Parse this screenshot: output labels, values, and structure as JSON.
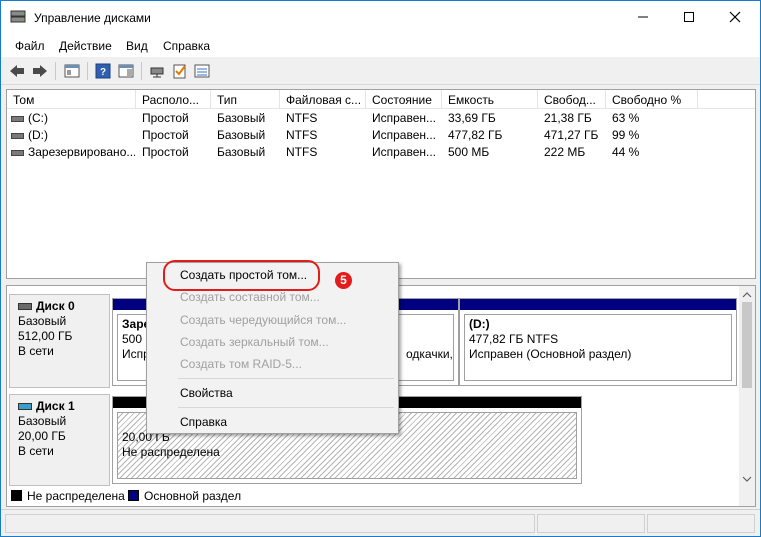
{
  "window": {
    "title": "Управление дисками"
  },
  "menu": [
    "Файл",
    "Действие",
    "Вид",
    "Справка"
  ],
  "volume_table": {
    "columns": [
      "Том",
      "Располо...",
      "Тип",
      "Файловая с...",
      "Состояние",
      "Емкость",
      "Свобод...",
      "Свободно %"
    ],
    "rows": [
      [
        "(C:)",
        "Простой",
        "Базовый",
        "NTFS",
        "Исправен...",
        "33,69 ГБ",
        "21,38 ГБ",
        "63 %"
      ],
      [
        "(D:)",
        "Простой",
        "Базовый",
        "NTFS",
        "Исправен...",
        "477,82 ГБ",
        "471,27 ГБ",
        "99 %"
      ],
      [
        "Зарезервировано...",
        "Простой",
        "Базовый",
        "NTFS",
        "Исправен...",
        "500 МБ",
        "222 МБ",
        "44 %"
      ]
    ]
  },
  "disks": [
    {
      "name": "Диск 0",
      "type": "Базовый",
      "size": "512,00 ГБ",
      "status": "В сети",
      "partitions": [
        {
          "name": "Заре",
          "line2": "500 М",
          "line3": "Испр"
        },
        {
          "name": "",
          "line2": "",
          "line3": "одкачки,"
        },
        {
          "name": "(D:)",
          "line2": "477,82 ГБ NTFS",
          "line3": "Исправен (Основной раздел)"
        }
      ]
    },
    {
      "name": "Диск 1",
      "type": "Базовый",
      "size": "20,00 ГБ",
      "status": "В сети",
      "partitions": [
        {
          "name": "",
          "line2": "20,00 ГБ",
          "line3": "Не распределена"
        }
      ]
    }
  ],
  "legend": [
    "Не распределена",
    "Основной раздел"
  ],
  "context_menu": {
    "items": [
      {
        "label": "Создать простой том...",
        "enabled": true
      },
      {
        "label": "Создать составной том...",
        "enabled": false
      },
      {
        "label": "Создать чередующийся том...",
        "enabled": false
      },
      {
        "label": "Создать зеркальный том...",
        "enabled": false
      },
      {
        "label": "Создать том RAID-5...",
        "enabled": false
      },
      {
        "label": "Свойства",
        "enabled": true
      },
      {
        "label": "Справка",
        "enabled": true
      }
    ]
  },
  "step_badge": "5",
  "colors": {
    "primary_partition": "#000080",
    "unallocated": "#000000",
    "annotation": "#e21b1b"
  }
}
